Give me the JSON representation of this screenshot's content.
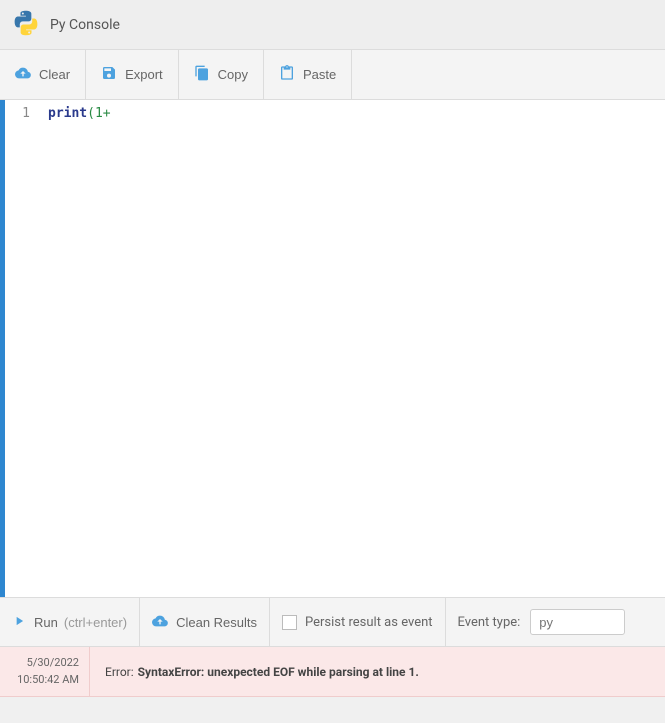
{
  "header": {
    "title": "Py Console"
  },
  "toolbar_top": {
    "clear": "Clear",
    "export": "Export",
    "copy": "Copy",
    "paste": "Paste"
  },
  "editor": {
    "line_number": "1",
    "code_fn": "print",
    "code_paren": "(",
    "code_num": "1",
    "code_op": "+"
  },
  "toolbar_bottom": {
    "run": "Run",
    "run_hint": "(ctrl+enter)",
    "clean": "Clean Results",
    "persist": "Persist result as event",
    "event_type_label": "Event type:",
    "event_type_placeholder": "py"
  },
  "result": {
    "date": "5/30/2022",
    "time": "10:50:42 AM",
    "error_label": "Error:",
    "error_msg": "SyntaxError: unexpected EOF while parsing at line 1."
  },
  "colors": {
    "accent": "#4da2df",
    "error_bg": "#fbe8e8"
  }
}
